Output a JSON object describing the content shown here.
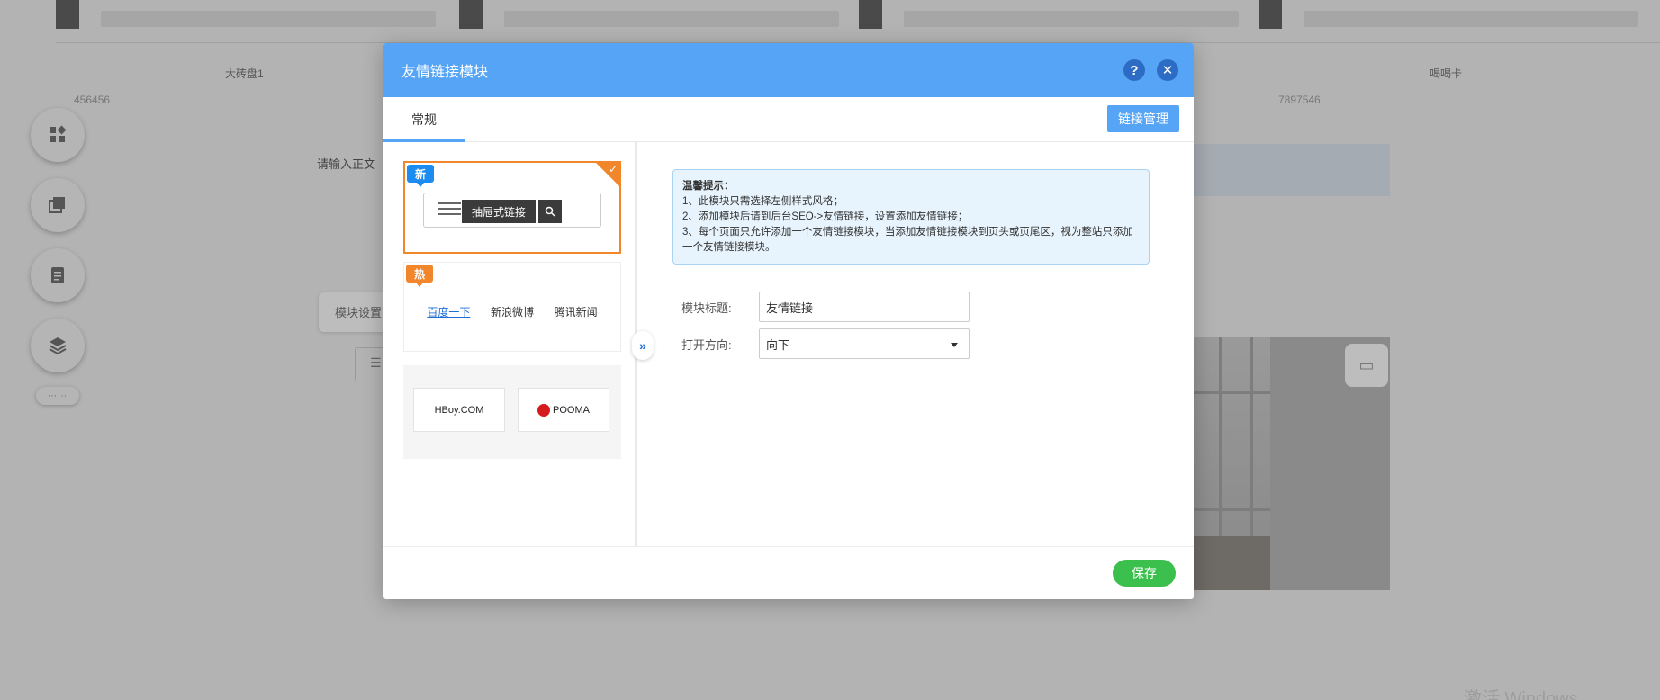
{
  "background": {
    "captions": [
      "大砖盘1",
      "喝喝卡"
    ],
    "numbers": [
      "456456",
      "7897546"
    ],
    "input_placeholder": "请输入正文",
    "module_settings": "模块设置",
    "watermark": "激活 Windows",
    "tools": [
      "add-module-icon",
      "copy-page-icon",
      "page-icon",
      "layers-icon"
    ],
    "handle_label": "⋯⋯"
  },
  "modal": {
    "title": "友情链接模块",
    "help_label": "?",
    "close_label": "✕",
    "tabs": [
      {
        "label": "常规"
      }
    ],
    "link_manage_label": "链接管理",
    "styles": {
      "style1": {
        "badge": "新",
        "drawer_label": "抽屉式链接"
      },
      "style2": {
        "badge": "热",
        "links": [
          "百度一下",
          "新浪微博",
          "腾讯新闻"
        ]
      },
      "style3": {
        "logos": [
          "HBoy.COM",
          "POOMA"
        ]
      }
    },
    "expand_label": "»",
    "tip": {
      "title": "温馨提示：",
      "lines": [
        "1、此模块只需选择左侧样式风格；",
        "2、添加模块后请到后台SEO->友情链接，设置添加友情链接；",
        "3、每个页面只允许添加一个友情链接模块，当添加友情链接模块到页头或页尾区，视为整站只添加一个友情链接模块。"
      ]
    },
    "form": {
      "title_label": "模块标题:",
      "title_value": "友情链接",
      "direction_label": "打开方向:",
      "direction_value": "向下"
    },
    "save_label": "保存"
  },
  "colors": {
    "header_blue": "#55a4f5",
    "selected_orange": "#f2862a",
    "save_green": "#3cc04d",
    "badge_blue": "#1d8cf0"
  }
}
